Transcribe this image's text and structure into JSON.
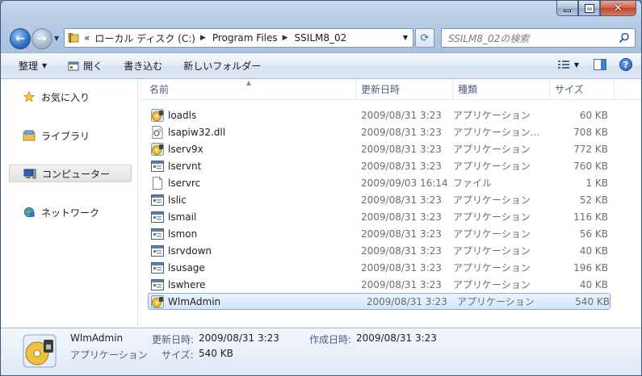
{
  "caption": {
    "minimize": "",
    "maximize": "",
    "close": "✕"
  },
  "address": {
    "overflow": "«",
    "segments": [
      "ローカル ディスク (C:)",
      "Program Files",
      "SSILM8_02"
    ]
  },
  "search": {
    "placeholder": "SSILM8_02の検索"
  },
  "toolbar": {
    "organize": "整理",
    "open": "開く",
    "burn": "書き込む",
    "new_folder": "新しいフォルダー"
  },
  "nav": {
    "favorites": "お気に入り",
    "libraries": "ライブラリ",
    "computer": "コンピューター",
    "network": "ネットワーク"
  },
  "columns": {
    "name": "名前",
    "date": "更新日時",
    "type": "種類",
    "size": "サイズ"
  },
  "files": [
    {
      "name": "loadls",
      "date": "2009/08/31 3:23",
      "type": "アプリケーション",
      "size": "60 KB",
      "icon": "app-disc-icon"
    },
    {
      "name": "lsapiw32.dll",
      "date": "2009/08/31 3:23",
      "type": "アプリケーション...",
      "size": "708 KB",
      "icon": "dll-icon"
    },
    {
      "name": "lserv9x",
      "date": "2009/08/31 3:23",
      "type": "アプリケーション",
      "size": "772 KB",
      "icon": "app-disc-icon"
    },
    {
      "name": "lservnt",
      "date": "2009/08/31 3:23",
      "type": "アプリケーション",
      "size": "760 KB",
      "icon": "window-app-icon"
    },
    {
      "name": "lservrc",
      "date": "2009/09/03 16:14",
      "type": "ファイル",
      "size": "1 KB",
      "icon": "blank-file-icon"
    },
    {
      "name": "lslic",
      "date": "2009/08/31 3:23",
      "type": "アプリケーション",
      "size": "52 KB",
      "icon": "window-app-icon"
    },
    {
      "name": "lsmail",
      "date": "2009/08/31 3:23",
      "type": "アプリケーション",
      "size": "116 KB",
      "icon": "window-app-icon"
    },
    {
      "name": "lsmon",
      "date": "2009/08/31 3:23",
      "type": "アプリケーション",
      "size": "56 KB",
      "icon": "window-app-icon"
    },
    {
      "name": "lsrvdown",
      "date": "2009/08/31 3:23",
      "type": "アプリケーション",
      "size": "40 KB",
      "icon": "window-app-icon"
    },
    {
      "name": "lsusage",
      "date": "2009/08/31 3:23",
      "type": "アプリケーション",
      "size": "196 KB",
      "icon": "window-app-icon"
    },
    {
      "name": "lswhere",
      "date": "2009/08/31 3:23",
      "type": "アプリケーション",
      "size": "40 KB",
      "icon": "window-app-icon"
    },
    {
      "name": "WlmAdmin",
      "date": "2009/08/31 3:23",
      "type": "アプリケーション",
      "size": "540 KB",
      "icon": "app-disc-icon",
      "selected": true
    }
  ],
  "details": {
    "name": "WlmAdmin",
    "type": "アプリケーション",
    "modified_label": "更新日時:",
    "modified_value": "2009/08/31 3:23",
    "size_label": "サイズ:",
    "size_value": "540 KB",
    "created_label": "作成日時:",
    "created_value": "2009/08/31 3:23"
  },
  "colors": {
    "accent": "#2f6fc2",
    "selection": "#d3e6fb",
    "selection_border": "#84acdd"
  }
}
